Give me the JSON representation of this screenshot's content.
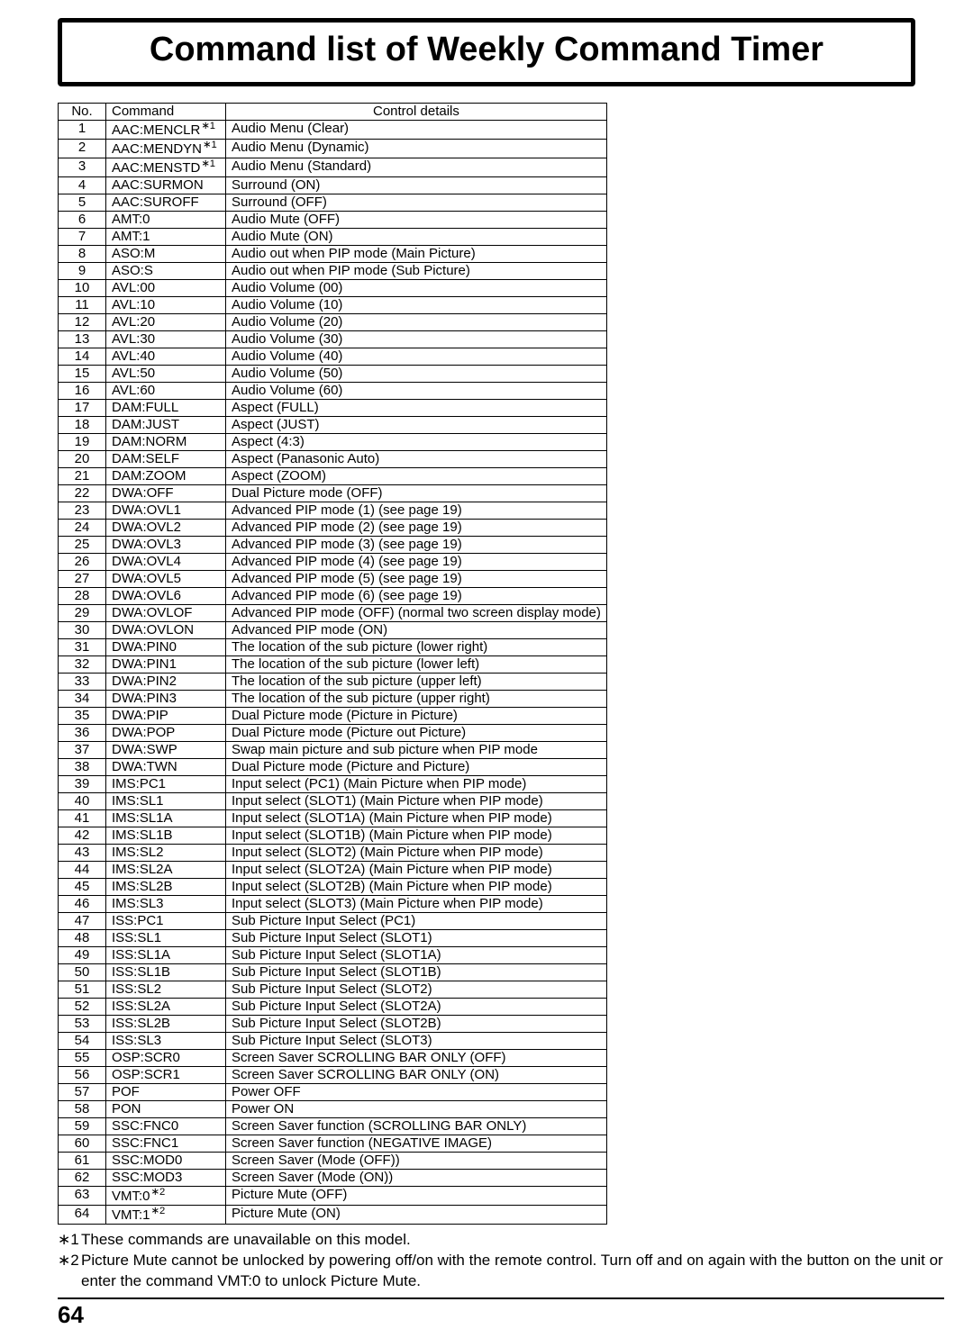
{
  "title": "Command list of Weekly Command Timer",
  "columns": {
    "no": "No.",
    "command": "Command",
    "details": "Control details"
  },
  "rows": [
    {
      "no": "1",
      "command": "AAC:MENCLR",
      "note": "1",
      "details": "Audio Menu (Clear)"
    },
    {
      "no": "2",
      "command": "AAC:MENDYN",
      "note": "1",
      "details": "Audio Menu (Dynamic)"
    },
    {
      "no": "3",
      "command": "AAC:MENSTD",
      "note": "1",
      "details": "Audio Menu (Standard)"
    },
    {
      "no": "4",
      "command": "AAC:SURMON",
      "details": "Surround (ON)"
    },
    {
      "no": "5",
      "command": "AAC:SUROFF",
      "details": "Surround (OFF)"
    },
    {
      "no": "6",
      "command": "AMT:0",
      "details": "Audio Mute (OFF)"
    },
    {
      "no": "7",
      "command": "AMT:1",
      "details": "Audio Mute (ON)"
    },
    {
      "no": "8",
      "command": "ASO:M",
      "details": "Audio out when PIP mode (Main Picture)"
    },
    {
      "no": "9",
      "command": "ASO:S",
      "details": "Audio out when PIP mode (Sub Picture)"
    },
    {
      "no": "10",
      "command": "AVL:00",
      "details": "Audio Volume (00)"
    },
    {
      "no": "11",
      "command": "AVL:10",
      "details": "Audio Volume (10)"
    },
    {
      "no": "12",
      "command": "AVL:20",
      "details": "Audio Volume (20)"
    },
    {
      "no": "13",
      "command": "AVL:30",
      "details": "Audio Volume (30)"
    },
    {
      "no": "14",
      "command": "AVL:40",
      "details": "Audio Volume (40)"
    },
    {
      "no": "15",
      "command": "AVL:50",
      "details": "Audio Volume (50)"
    },
    {
      "no": "16",
      "command": "AVL:60",
      "details": "Audio Volume (60)"
    },
    {
      "no": "17",
      "command": "DAM:FULL",
      "details": "Aspect (FULL)"
    },
    {
      "no": "18",
      "command": "DAM:JUST",
      "details": "Aspect (JUST)"
    },
    {
      "no": "19",
      "command": "DAM:NORM",
      "details": "Aspect (4:3)"
    },
    {
      "no": "20",
      "command": "DAM:SELF",
      "details": "Aspect (Panasonic Auto)"
    },
    {
      "no": "21",
      "command": "DAM:ZOOM",
      "details": "Aspect (ZOOM)"
    },
    {
      "no": "22",
      "command": "DWA:OFF",
      "details": "Dual Picture mode (OFF)"
    },
    {
      "no": "23",
      "command": "DWA:OVL1",
      "details": "Advanced PIP mode (1) (see page 19)"
    },
    {
      "no": "24",
      "command": "DWA:OVL2",
      "details": "Advanced PIP mode (2) (see page 19)"
    },
    {
      "no": "25",
      "command": "DWA:OVL3",
      "details": "Advanced PIP mode (3) (see page 19)"
    },
    {
      "no": "26",
      "command": "DWA:OVL4",
      "details": "Advanced PIP mode (4) (see page 19)"
    },
    {
      "no": "27",
      "command": "DWA:OVL5",
      "details": "Advanced PIP mode (5) (see page 19)"
    },
    {
      "no": "28",
      "command": "DWA:OVL6",
      "details": "Advanced PIP mode (6) (see page 19)"
    },
    {
      "no": "29",
      "command": "DWA:OVLOF",
      "details": "Advanced PIP mode (OFF) (normal two screen display mode)"
    },
    {
      "no": "30",
      "command": "DWA:OVLON",
      "details": "Advanced PIP mode (ON)"
    },
    {
      "no": "31",
      "command": "DWA:PIN0",
      "details": "The location of the sub picture (lower right)"
    },
    {
      "no": "32",
      "command": "DWA:PIN1",
      "details": "The location of the sub picture (lower left)"
    },
    {
      "no": "33",
      "command": "DWA:PIN2",
      "details": "The location of the sub picture (upper left)"
    },
    {
      "no": "34",
      "command": "DWA:PIN3",
      "details": "The location of the sub picture (upper right)"
    },
    {
      "no": "35",
      "command": "DWA:PIP",
      "details": "Dual Picture mode (Picture in Picture)"
    },
    {
      "no": "36",
      "command": "DWA:POP",
      "details": "Dual Picture mode (Picture out Picture)"
    },
    {
      "no": "37",
      "command": "DWA:SWP",
      "details": "Swap main picture and sub picture when PIP mode"
    },
    {
      "no": "38",
      "command": "DWA:TWN",
      "details": "Dual Picture mode (Picture and Picture)"
    },
    {
      "no": "39",
      "command": "IMS:PC1",
      "details": "Input select (PC1) (Main Picture when PIP mode)"
    },
    {
      "no": "40",
      "command": "IMS:SL1",
      "details": "Input select (SLOT1) (Main Picture when PIP mode)"
    },
    {
      "no": "41",
      "command": "IMS:SL1A",
      "details": "Input select (SLOT1A) (Main Picture when PIP mode)"
    },
    {
      "no": "42",
      "command": "IMS:SL1B",
      "details": "Input select (SLOT1B) (Main Picture when PIP mode)"
    },
    {
      "no": "43",
      "command": "IMS:SL2",
      "details": "Input select (SLOT2) (Main Picture when PIP mode)"
    },
    {
      "no": "44",
      "command": "IMS:SL2A",
      "details": "Input select (SLOT2A) (Main Picture when PIP mode)"
    },
    {
      "no": "45",
      "command": "IMS:SL2B",
      "details": "Input select (SLOT2B) (Main Picture when PIP mode)"
    },
    {
      "no": "46",
      "command": "IMS:SL3",
      "details": "Input select (SLOT3) (Main Picture when PIP mode)"
    },
    {
      "no": "47",
      "command": "ISS:PC1",
      "details": "Sub Picture Input Select (PC1)"
    },
    {
      "no": "48",
      "command": "ISS:SL1",
      "details": "Sub Picture Input Select (SLOT1)"
    },
    {
      "no": "49",
      "command": "ISS:SL1A",
      "details": "Sub Picture Input Select (SLOT1A)"
    },
    {
      "no": "50",
      "command": "ISS:SL1B",
      "details": "Sub Picture Input Select (SLOT1B)"
    },
    {
      "no": "51",
      "command": "ISS:SL2",
      "details": "Sub Picture Input Select (SLOT2)"
    },
    {
      "no": "52",
      "command": "ISS:SL2A",
      "details": "Sub Picture Input Select (SLOT2A)"
    },
    {
      "no": "53",
      "command": "ISS:SL2B",
      "details": "Sub Picture Input Select (SLOT2B)"
    },
    {
      "no": "54",
      "command": "ISS:SL3",
      "details": "Sub Picture Input Select (SLOT3)"
    },
    {
      "no": "55",
      "command": "OSP:SCR0",
      "details": "Screen Saver SCROLLING BAR ONLY (OFF)"
    },
    {
      "no": "56",
      "command": "OSP:SCR1",
      "details": "Screen Saver SCROLLING BAR ONLY (ON)"
    },
    {
      "no": "57",
      "command": "POF",
      "details": "Power OFF"
    },
    {
      "no": "58",
      "command": "PON",
      "details": "Power ON"
    },
    {
      "no": "59",
      "command": "SSC:FNC0",
      "details": "Screen Saver function (SCROLLING BAR ONLY)"
    },
    {
      "no": "60",
      "command": "SSC:FNC1",
      "details": "Screen Saver function (NEGATIVE IMAGE)"
    },
    {
      "no": "61",
      "command": "SSC:MOD0",
      "details": "Screen Saver (Mode (OFF))"
    },
    {
      "no": "62",
      "command": "SSC:MOD3",
      "details": "Screen Saver (Mode (ON))"
    },
    {
      "no": "63",
      "command": "VMT:0",
      "note": "2",
      "details": "Picture Mute (OFF)"
    },
    {
      "no": "64",
      "command": "VMT:1",
      "note": "2",
      "details": "Picture Mute (ON)"
    }
  ],
  "note_symbol": "∗",
  "footnotes": [
    {
      "sym": "∗1",
      "text": "These commands are unavailable on this model."
    },
    {
      "sym": "∗2",
      "text": "Picture Mute cannot be unlocked by powering off/on with the remote control. Turn off and on again with the button on the unit or enter the command VMT:0 to unlock Picture Mute."
    }
  ],
  "page_number": "64"
}
